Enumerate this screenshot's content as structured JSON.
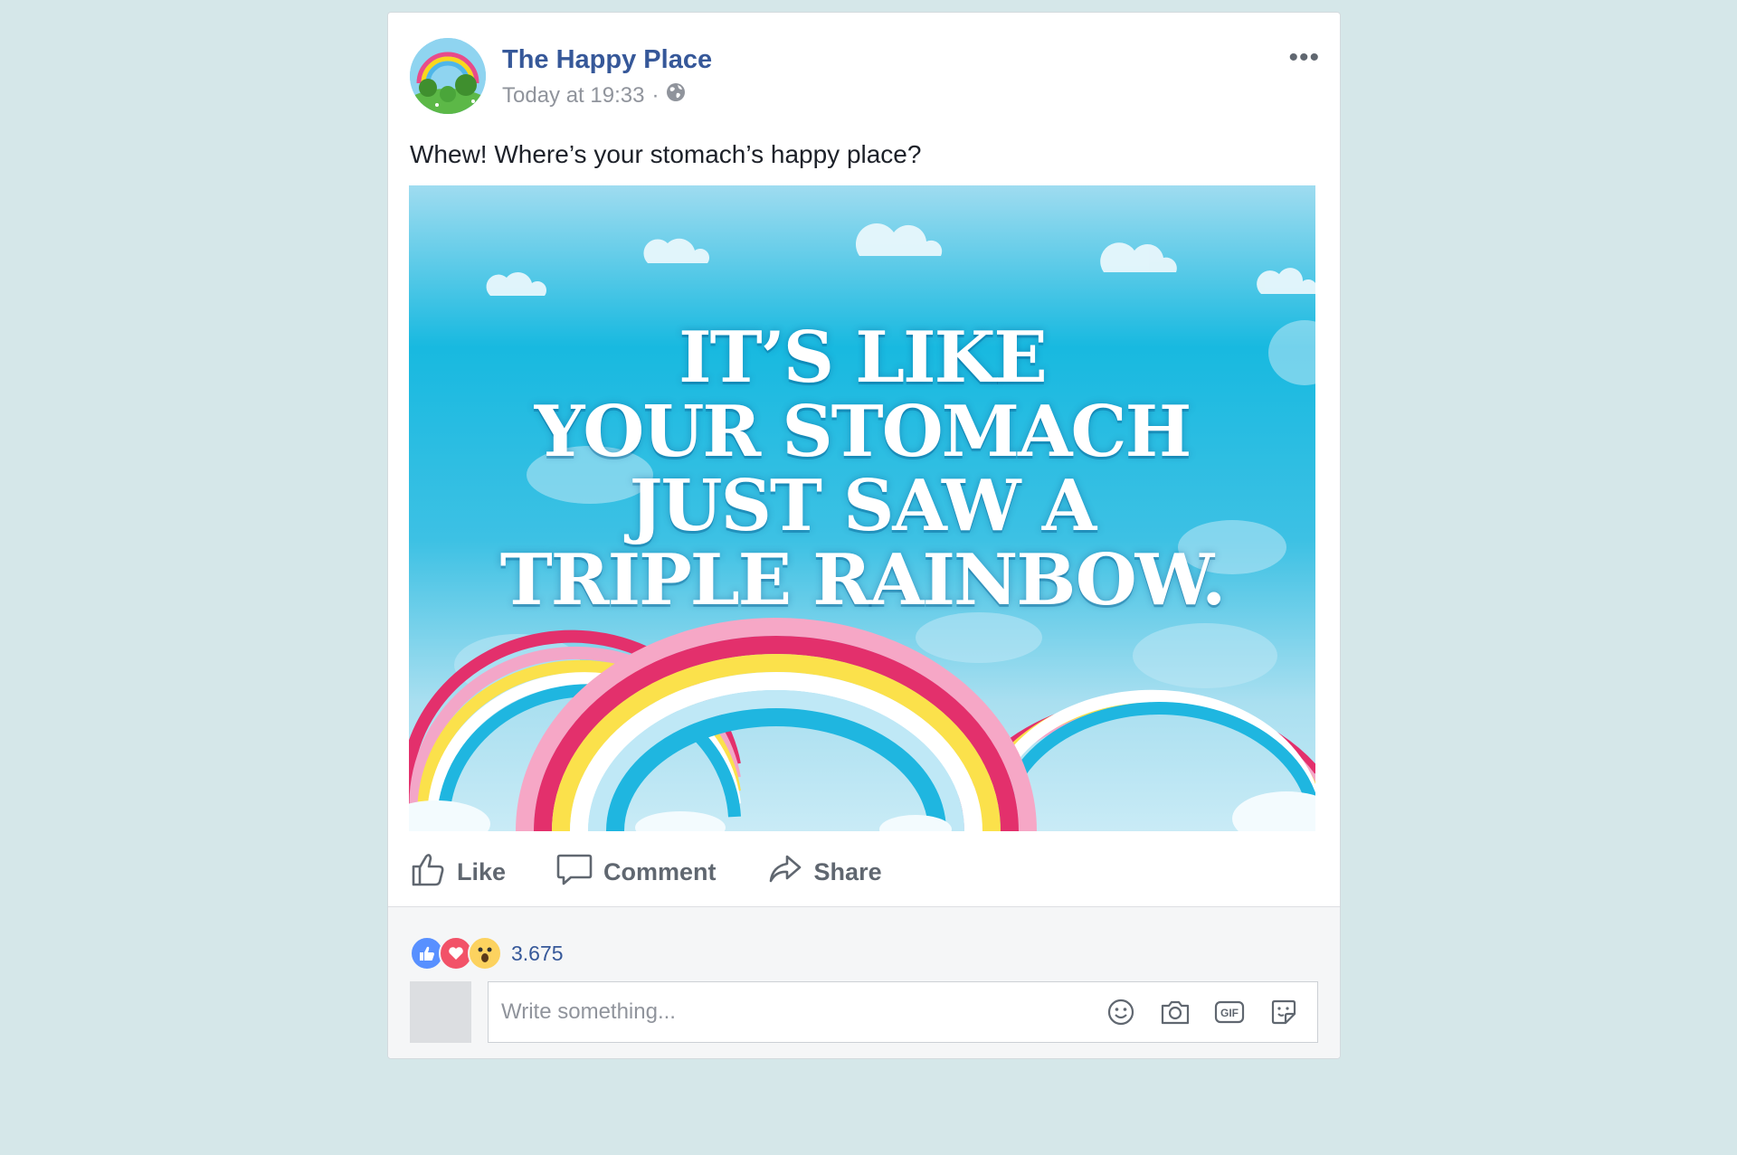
{
  "post": {
    "page_name": "The Happy Place",
    "timestamp": "Today at 19:33",
    "separator": "·",
    "privacy_icon": "globe-icon",
    "more_label": "•••",
    "text": "Whew! Where’s your stomach’s happy place?",
    "image": {
      "headline_lines": [
        "IT’S LIKE",
        "YOUR STOMACH",
        "JUST SAW A",
        "TRIPLE RAINBOW."
      ]
    },
    "actions": {
      "like": "Like",
      "comment": "Comment",
      "share": "Share"
    }
  },
  "footer": {
    "reactions": [
      "like-reaction-icon",
      "love-reaction-icon",
      "wow-reaction-icon"
    ],
    "reaction_count": "3.675",
    "composer_placeholder": "Write something...",
    "composer_tools": [
      "emoji-icon",
      "camera-icon",
      "gif-icon",
      "sticker-icon"
    ],
    "gif_label": "GIF"
  },
  "colors": {
    "link": "#365899",
    "like_blue": "#5890ff",
    "love_red": "#f25268",
    "wow_yellow": "#fcd25f"
  }
}
